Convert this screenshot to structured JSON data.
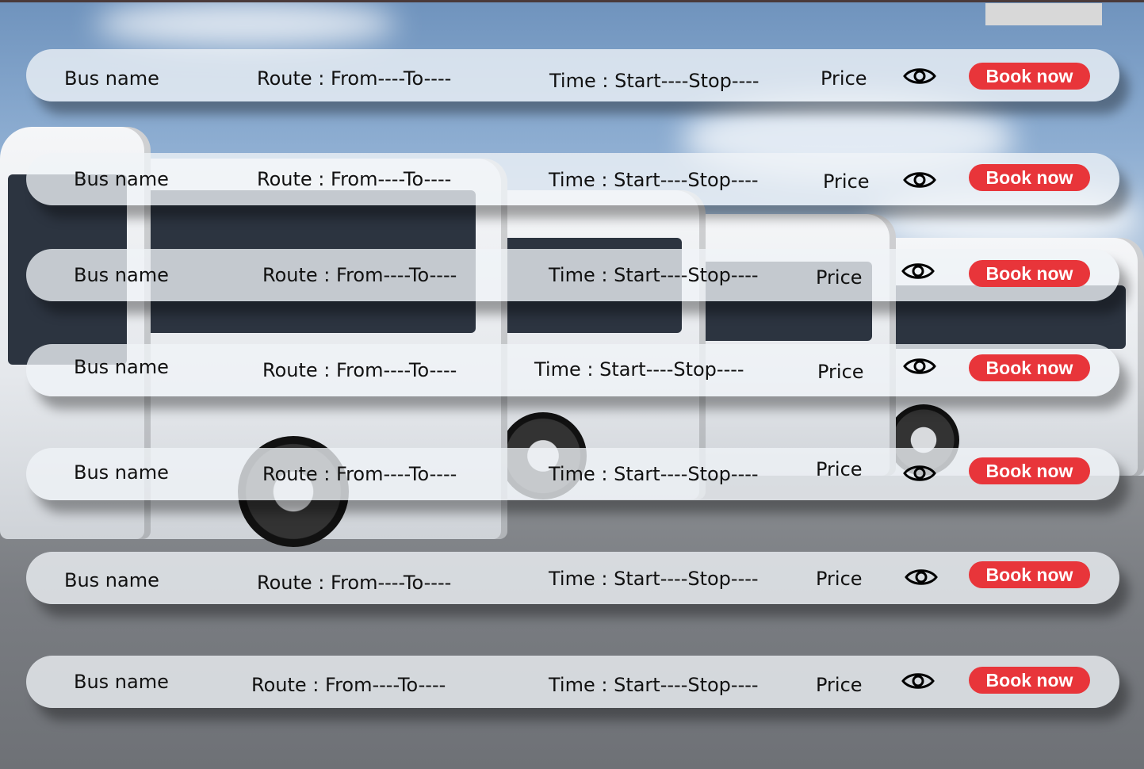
{
  "rows": [
    {
      "bus_name": "Bus name",
      "route": "Route : From----To----",
      "time": "Time : Start----Stop----",
      "price": "Price",
      "book_label": "Book now"
    },
    {
      "bus_name": "Bus name",
      "route": "Route : From----To----",
      "time": "Time : Start----Stop----",
      "price": "Price",
      "book_label": "Book now"
    },
    {
      "bus_name": "Bus name",
      "route": "Route : From----To----",
      "time": "Time : Start----Stop----",
      "price": "Price",
      "book_label": "Book now"
    },
    {
      "bus_name": "Bus name",
      "route": "Route : From----To----",
      "time": "Time : Start----Stop----",
      "price": "Price",
      "book_label": "Book now"
    },
    {
      "bus_name": "Bus name",
      "route": "Route : From----To----",
      "time": "Time : Start----Stop----",
      "price": "Price",
      "book_label": "Book now"
    },
    {
      "bus_name": "Bus name",
      "route": "Route : From----To----",
      "time": "Time : Start----Stop----",
      "price": "Price",
      "book_label": "Book now"
    },
    {
      "bus_name": "Bus name",
      "route": "Route : From----To----",
      "time": "Time : Start----Stop----",
      "price": "Price",
      "book_label": "Book now"
    }
  ],
  "icons": {
    "view": "eye-icon"
  },
  "colors": {
    "accent": "#e8353a",
    "row_bg": "#f0f3f7"
  }
}
